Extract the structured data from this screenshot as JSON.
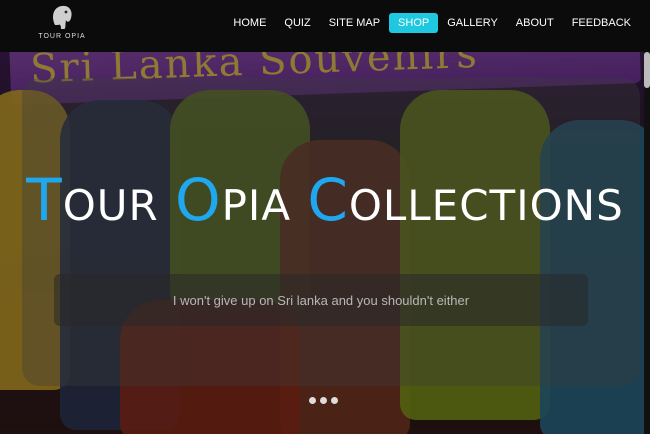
{
  "logo": {
    "text": "TOUR OPIA"
  },
  "nav": [
    {
      "label": "HOME"
    },
    {
      "label": "QUIZ"
    },
    {
      "label": "SITE MAP"
    },
    {
      "label": "SHOP",
      "active": true
    },
    {
      "label": "GALLERY"
    },
    {
      "label": "ABOUT"
    },
    {
      "label": "FEEDBACK"
    }
  ],
  "hero": {
    "banner_text": "Sri Lanka Souvenirs",
    "title": {
      "w1_first": "T",
      "w1_rest": "OUR",
      "w2_first": "O",
      "w2_rest": "PIA",
      "w3_first": "C",
      "w3_rest": "OLLECTIONS"
    },
    "subtitle": "I won't give up on Sri lanka and you shouldn't either"
  },
  "colors": {
    "accent": "#1fa8f0",
    "active_nav": "#1ec8e0",
    "navbar": "#0b0b0b"
  },
  "carousel": {
    "dots": 3
  }
}
